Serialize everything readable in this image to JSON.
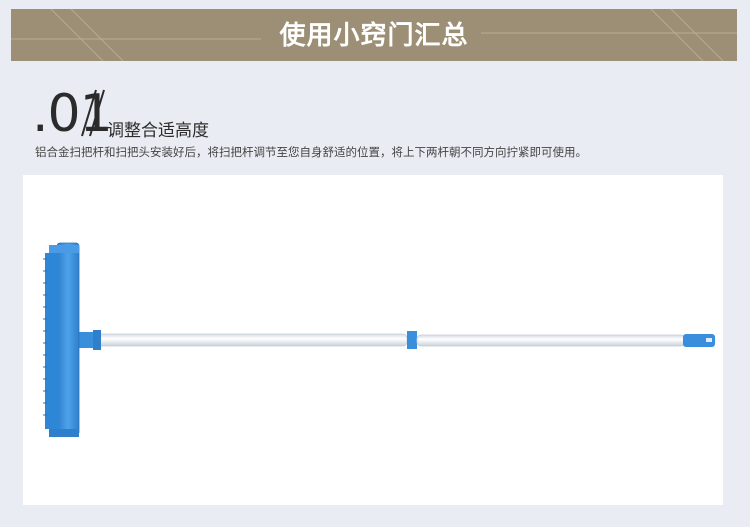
{
  "header": {
    "title": "使用小窍门汇总"
  },
  "step": {
    "number": ".01",
    "title": "调整合适高度",
    "description": "铝合金扫把杆和扫把头安装好后，将扫把杆调节至您自身舒适的位置，将上下两杆朝不同方向拧紧即可使用。"
  },
  "colors": {
    "banner": "#9c8f75",
    "background": "#e9ecf2",
    "broom_blue": "#3a8fdc",
    "handle_white": "#eef2f6"
  },
  "icons": {
    "slash": "double-slash-mark",
    "product": "rubber-broom-image"
  }
}
